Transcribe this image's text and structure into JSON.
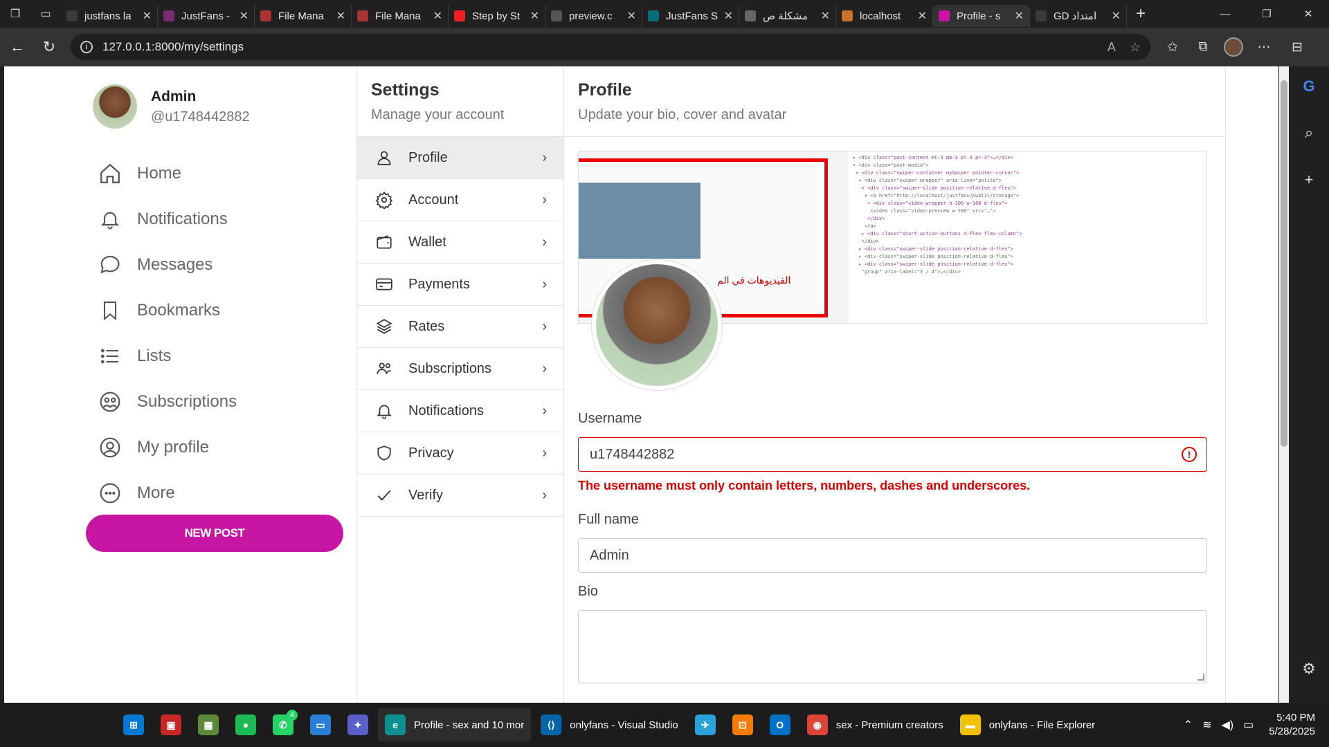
{
  "browser": {
    "tabs": [
      {
        "label": "justfans la",
        "color": "#3a3a3a"
      },
      {
        "label": "JustFans -",
        "color": "#7a2d6e"
      },
      {
        "label": "File Mana",
        "color": "#a33"
      },
      {
        "label": "File Mana",
        "color": "#a33"
      },
      {
        "label": "Step by St",
        "color": "#e22"
      },
      {
        "label": "preview.c",
        "color": "#555"
      },
      {
        "label": "JustFans S",
        "color": "#0a6e7a"
      },
      {
        "label": "مشكلة ص",
        "color": "#666"
      },
      {
        "label": "localhost",
        "color": "#c7742a"
      },
      {
        "label": "Profile - s",
        "color": "#c616a3"
      },
      {
        "label": "GD امتداد",
        "color": "#3a3a3a"
      }
    ],
    "active_tab_index": 9,
    "url": "127.0.0.1:8000/my/settings"
  },
  "sidebar": {
    "user_name": "Admin",
    "user_handle": "@u1748442882",
    "items": [
      {
        "label": "Home",
        "icon": "home-icon"
      },
      {
        "label": "Notifications",
        "icon": "bell-icon"
      },
      {
        "label": "Messages",
        "icon": "chat-icon"
      },
      {
        "label": "Bookmarks",
        "icon": "bookmark-icon"
      },
      {
        "label": "Lists",
        "icon": "list-icon"
      },
      {
        "label": "Subscriptions",
        "icon": "people-icon"
      },
      {
        "label": "My profile",
        "icon": "user-circle-icon"
      },
      {
        "label": "More",
        "icon": "more-icon"
      }
    ],
    "new_post_label": "NEW POST"
  },
  "settings": {
    "title": "Settings",
    "subtitle": "Manage your account",
    "items": [
      {
        "label": "Profile",
        "icon": "user-icon"
      },
      {
        "label": "Account",
        "icon": "gear-icon"
      },
      {
        "label": "Wallet",
        "icon": "wallet-icon"
      },
      {
        "label": "Payments",
        "icon": "card-icon"
      },
      {
        "label": "Rates",
        "icon": "layers-icon"
      },
      {
        "label": "Subscriptions",
        "icon": "people-icon"
      },
      {
        "label": "Notifications",
        "icon": "bell-icon"
      },
      {
        "label": "Privacy",
        "icon": "shield-icon"
      },
      {
        "label": "Verify",
        "icon": "check-icon"
      }
    ]
  },
  "profile": {
    "title": "Profile",
    "subtitle": "Update your bio, cover and avatar",
    "cover_arabic_text": "الفيديوهات في الم",
    "username_label": "Username",
    "username_value": "u1748442882",
    "username_error": "The username must only contain letters, numbers, dashes and underscores.",
    "fullname_label": "Full name",
    "fullname_value": "Admin",
    "bio_label": "Bio",
    "bio_value": ""
  },
  "taskbar": {
    "items": [
      {
        "label": "",
        "color": "#0078d4"
      },
      {
        "label": "",
        "color": "#c62828"
      },
      {
        "label": "",
        "color": "#5d8a3a"
      },
      {
        "label": "",
        "color": "#1db954"
      },
      {
        "label": "",
        "color": "#25d366"
      },
      {
        "label": "",
        "color": "#2a7fd4"
      },
      {
        "label": "",
        "color": "#5b5fc7"
      },
      {
        "label": "Profile - sex and 10 mor",
        "color": "#0c8f8f"
      },
      {
        "label": "onlyfans - Visual Studio",
        "color": "#0065a9"
      },
      {
        "label": "",
        "color": "#2aa1da"
      },
      {
        "label": "",
        "color": "#f57c00"
      },
      {
        "label": "",
        "color": "#0072c6"
      },
      {
        "label": "sex - Premium creators",
        "color": "#db4437"
      },
      {
        "label": "onlyfans - File Explorer",
        "color": "#f2c200"
      }
    ],
    "whatsapp_badge": "4",
    "time": "5:40 PM",
    "date": "5/28/2025"
  },
  "colors": {
    "accent": "#c616a3",
    "error": "#dd0000"
  }
}
